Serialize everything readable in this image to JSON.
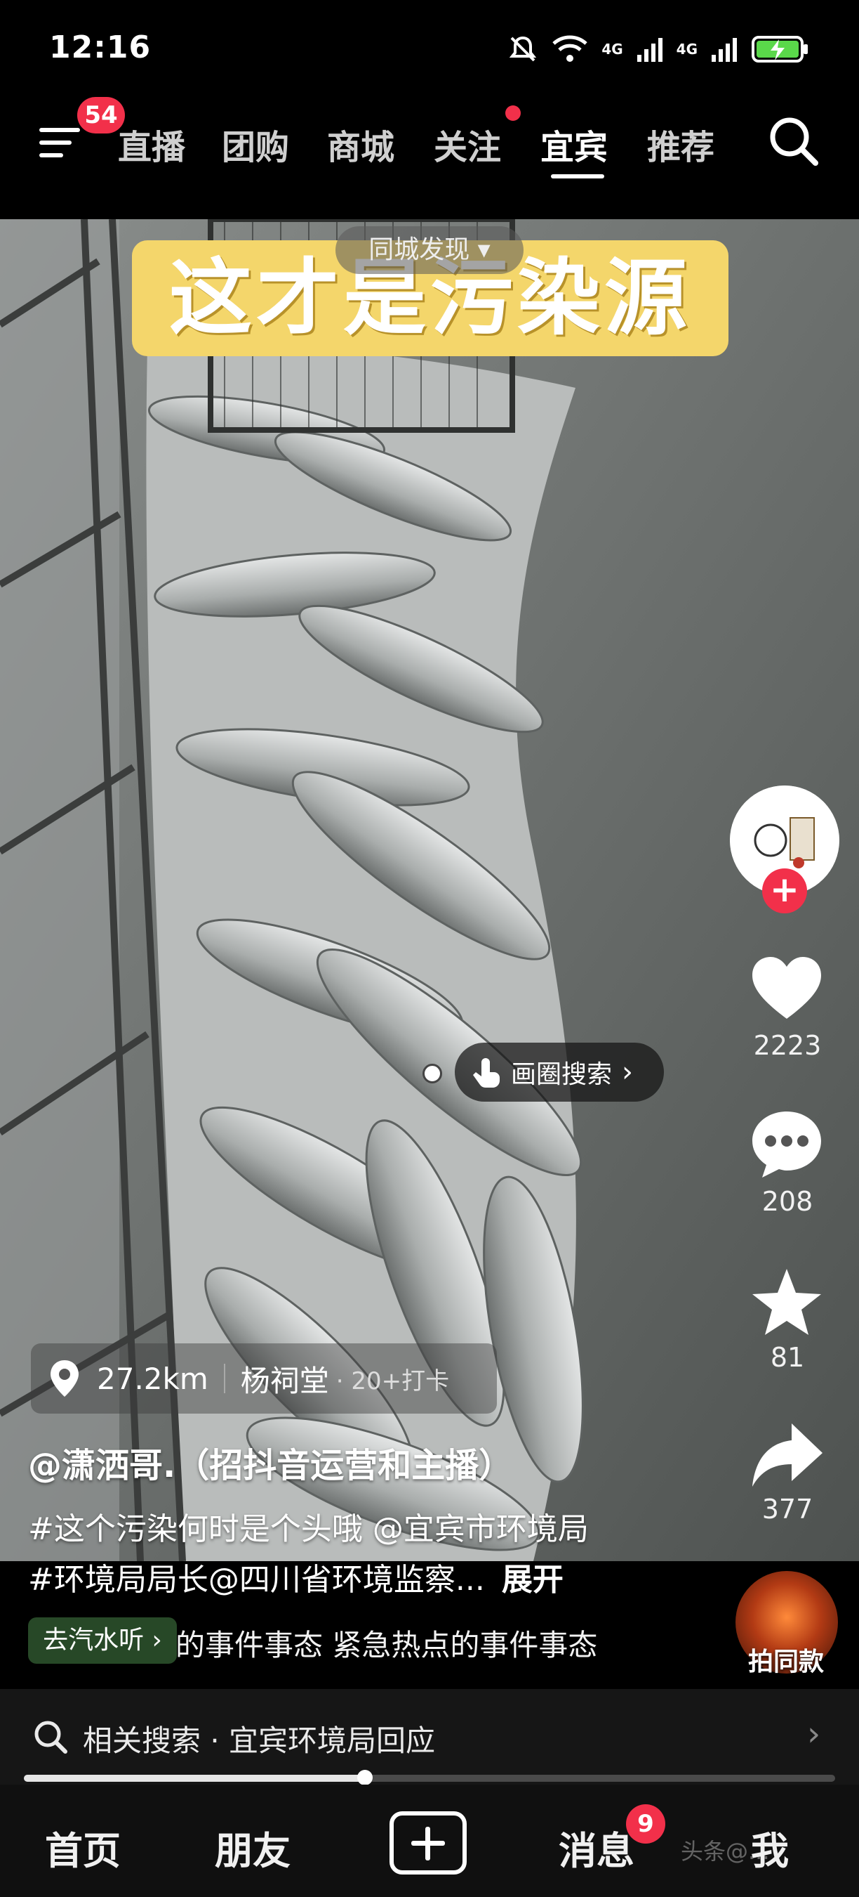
{
  "status_bar": {
    "time": "12:16",
    "net1": "4G",
    "net2": "4G"
  },
  "top_nav": {
    "menu_badge": "54",
    "tabs": [
      "直播",
      "团购",
      "商城",
      "关注",
      "宜宾",
      "推荐"
    ],
    "active_tab": "宜宾"
  },
  "video": {
    "city_discover": "同城发现 ▾",
    "title_caption": "这才是污染源",
    "circle_search_label": "画圈搜索",
    "location": {
      "distance": "27.2km",
      "place": "杨祠堂",
      "checkins": "· 20+打卡"
    },
    "author": "@潇洒哥.（招抖音运营和主播）",
    "description_line1": "#这个污染何时是个头哦 @宜宾市环境局",
    "description_line2": "#环境局局长@四川省环境监察...",
    "expand_label": "展开",
    "music_pill": "去汽水听 ›",
    "music_text": "的事件事态    紧急热点的事件事态",
    "same_style_label": "拍同款"
  },
  "right_rail": {
    "likes": "2223",
    "comments": "208",
    "favorites": "81",
    "shares": "377"
  },
  "related_search": {
    "text": "相关搜索 · 宜宾环境局回应"
  },
  "playback_progress": 0.42,
  "bottom_nav": {
    "home": "首页",
    "friends": "朋友",
    "messages": "消息",
    "messages_badge": "9",
    "me": "我"
  },
  "watermark": "头条@..."
}
